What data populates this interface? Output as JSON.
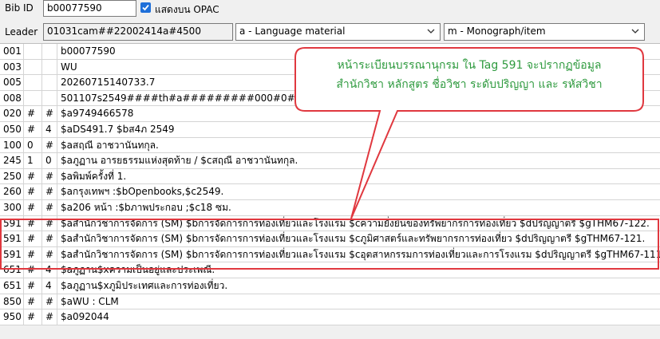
{
  "header": {
    "bib_id_label": "Bib ID",
    "bib_id_value": "b00077590",
    "opac_checkbox_label": "แสดงบน OPAC",
    "leader_label": "Leader",
    "leader_value": "01031cam##22002414a#4500",
    "type_select_value": "a - Language material",
    "level_select_value": "m - Monograph/item"
  },
  "records": [
    {
      "tag": "001",
      "ind1": "",
      "ind2": "",
      "data": "b00077590"
    },
    {
      "tag": "003",
      "ind1": "",
      "ind2": "",
      "data": "WU"
    },
    {
      "tag": "005",
      "ind1": "",
      "ind2": "",
      "data": "20260715140733.7"
    },
    {
      "tag": "008",
      "ind1": "",
      "ind2": "",
      "data": "501107s2549####th#a#########000#0#tha#d"
    },
    {
      "tag": "020",
      "ind1": "#",
      "ind2": "#",
      "data": "$a9749466578"
    },
    {
      "tag": "050",
      "ind1": "#",
      "ind2": "4",
      "data": "$aDS491.7 $bส4ภ 2549"
    },
    {
      "tag": "100",
      "ind1": "0",
      "ind2": "#",
      "data": "$aสฤณี อาชวานันทกุล."
    },
    {
      "tag": "245",
      "ind1": "1",
      "ind2": "0",
      "data": "$aภูฏาน อารยธรรมแห่งสุดท้าย / $cสฤณี อาชวานันทกุล."
    },
    {
      "tag": "250",
      "ind1": "#",
      "ind2": "#",
      "data": "$aพิมพ์ครั้งที่ 1."
    },
    {
      "tag": "260",
      "ind1": "#",
      "ind2": "#",
      "data": "$aกรุงเทพฯ :$bOpenbooks,$c2549."
    },
    {
      "tag": "300",
      "ind1": "#",
      "ind2": "#",
      "data": "$a206 หน้า :$bภาพประกอบ ;$c18 ซม."
    },
    {
      "tag": "591",
      "ind1": "#",
      "ind2": "#",
      "data": "$aสำนักวิชาการจัดการ (SM) $bการจัดการการท่องเที่ยวและโรงแรม $cความยั่งยืนของทรัพยากรการท่องเที่ยว $dปริญญาตรี $gTHM67-122."
    },
    {
      "tag": "591",
      "ind1": "#",
      "ind2": "#",
      "data": "$aสำนักวิชาการจัดการ (SM) $bการจัดการการท่องเที่ยวและโรงแรม $cภูมิศาสตร์และทรัพยากรการท่องเที่ยว $dปริญญาตรี $gTHM67-121."
    },
    {
      "tag": "591",
      "ind1": "#",
      "ind2": "#",
      "data": "$aสำนักวิชาการจัดการ (SM) $bการจัดการการท่องเที่ยวและโรงแรม $cอุตสาหกรรมการท่องเที่ยวและการโรงแรม $dปริญญาตรี $gTHM67-111"
    },
    {
      "tag": "651",
      "ind1": "#",
      "ind2": "4",
      "data": "$aภูฏาน$xความเป็นอยู่และประเพณี."
    },
    {
      "tag": "651",
      "ind1": "#",
      "ind2": "4",
      "data": "$aภูฏาน$xภูมิประเทศและการท่องเที่ยว."
    },
    {
      "tag": "850",
      "ind1": "#",
      "ind2": "#",
      "data": "$aWU : CLM"
    },
    {
      "tag": "950",
      "ind1": "#",
      "ind2": "#",
      "data": "$a092044"
    }
  ],
  "annotation": {
    "line1": "หน้าระเบียนบรรณานุกรม ใน Tag 591 จะปรากฏข้อมูล",
    "line2": "สำนักวิชา หลักสูตร ชื่อวิชา ระดับปริญญา และ รหัสวิชา"
  },
  "colors": {
    "annotation_border": "#e0383f",
    "annotation_text": "#2e9a3e",
    "checkbox": "#1e6fd9"
  },
  "icons": {
    "checkbox": "checkmark-icon",
    "dropdown": "chevron-down-icon"
  }
}
